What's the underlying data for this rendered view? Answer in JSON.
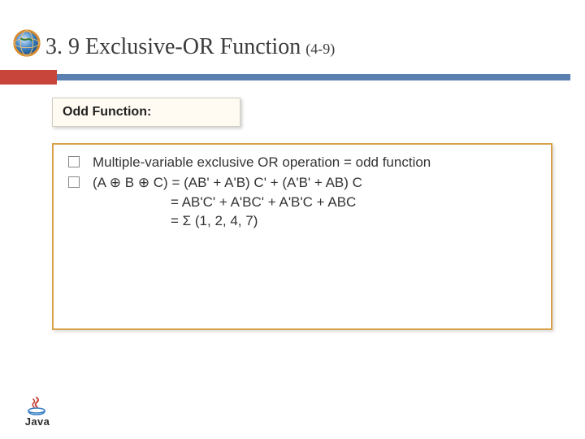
{
  "title": {
    "main": "3. 9 Exclusive-OR Function",
    "sub": "(4-9)"
  },
  "subtitle_card": "Odd Function:",
  "bullets": [
    {
      "text": "Multiple-variable exclusive OR operation = odd function"
    },
    {
      "text": "(A ⊕ B ⊕ C) = (AB' + A'B) C' + (A'B' + AB) C",
      "cont1": "= AB'C' + A'BC' + A'B'C + ABC",
      "cont2": "= Σ (1, 2, 4, 7)"
    }
  ],
  "logos": {
    "globe_name": "net-globe-icon",
    "java_text": "Java"
  }
}
